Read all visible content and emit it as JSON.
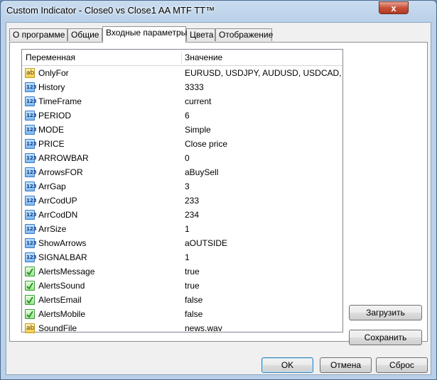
{
  "window": {
    "title": "Custom Indicator - Close0 vs Close1 AA MTF TT™",
    "close_glyph": "x"
  },
  "tabs": [
    "О программе",
    "Общие",
    "Входные параметры",
    "Цвета",
    "Отображение"
  ],
  "grid": {
    "headers": {
      "variable": "Переменная",
      "value": "Значение"
    },
    "rows": [
      {
        "name": "OnlyFor",
        "value": "EURUSD, USDJPY, AUDUSD, USDCAD, C...",
        "type": "string",
        "icon": "string-type-icon",
        "icon_text": "ab"
      },
      {
        "name": "History",
        "value": "3333",
        "type": "int",
        "icon": "integer-type-icon",
        "icon_text": "123"
      },
      {
        "name": "TimeFrame",
        "value": "current",
        "type": "int",
        "icon": "integer-type-icon",
        "icon_text": "123"
      },
      {
        "name": "PERIOD",
        "value": "6",
        "type": "int",
        "icon": "integer-type-icon",
        "icon_text": "123"
      },
      {
        "name": "MODE",
        "value": "Simple",
        "type": "int",
        "icon": "integer-type-icon",
        "icon_text": "123"
      },
      {
        "name": "PRICE",
        "value": "Close price",
        "type": "int",
        "icon": "integer-type-icon",
        "icon_text": "123"
      },
      {
        "name": "ARROWBAR",
        "value": "0",
        "type": "int",
        "icon": "integer-type-icon",
        "icon_text": "123"
      },
      {
        "name": "ArrowsFOR",
        "value": "aBuySell",
        "type": "int",
        "icon": "integer-type-icon",
        "icon_text": "123"
      },
      {
        "name": "ArrGap",
        "value": "3",
        "type": "int",
        "icon": "integer-type-icon",
        "icon_text": "123"
      },
      {
        "name": "ArrCodUP",
        "value": "233",
        "type": "int",
        "icon": "integer-type-icon",
        "icon_text": "123"
      },
      {
        "name": "ArrCodDN",
        "value": "234",
        "type": "int",
        "icon": "integer-type-icon",
        "icon_text": "123"
      },
      {
        "name": "ArrSize",
        "value": "1",
        "type": "int",
        "icon": "integer-type-icon",
        "icon_text": "123"
      },
      {
        "name": "ShowArrows",
        "value": "aOUTSIDE",
        "type": "int",
        "icon": "integer-type-icon",
        "icon_text": "123"
      },
      {
        "name": "SIGNALBAR",
        "value": "1",
        "type": "int",
        "icon": "integer-type-icon",
        "icon_text": "123"
      },
      {
        "name": "AlertsMessage",
        "value": "true",
        "type": "bool",
        "icon": "boolean-type-icon",
        "icon_text": ""
      },
      {
        "name": "AlertsSound",
        "value": "true",
        "type": "bool",
        "icon": "boolean-type-icon",
        "icon_text": ""
      },
      {
        "name": "AlertsEmail",
        "value": "false",
        "type": "bool",
        "icon": "boolean-type-icon",
        "icon_text": ""
      },
      {
        "name": "AlertsMobile",
        "value": "false",
        "type": "bool",
        "icon": "boolean-type-icon",
        "icon_text": ""
      },
      {
        "name": "SoundFile",
        "value": "news.wav",
        "type": "string",
        "icon": "string-type-icon",
        "icon_text": "ab"
      }
    ]
  },
  "side_buttons": {
    "load": "Загрузить",
    "save": "Сохранить"
  },
  "footer_buttons": {
    "ok": "OK",
    "cancel": "Отмена",
    "reset": "Сброс"
  },
  "colors": {
    "title_bar": "#b9d0e8",
    "close_button": "#c8513a",
    "bool_check": "#2f8f2f"
  }
}
